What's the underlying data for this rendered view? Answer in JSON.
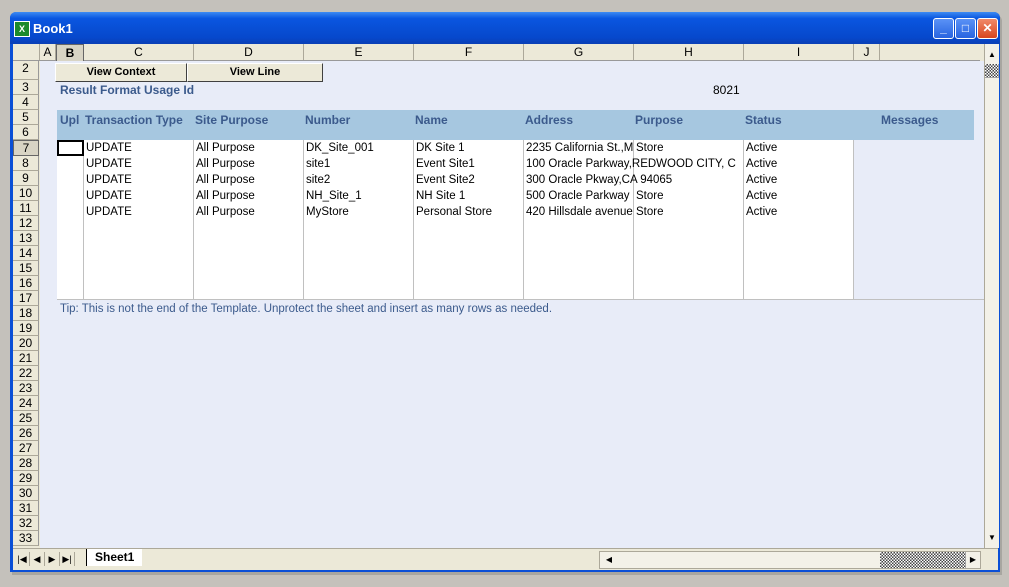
{
  "window": {
    "title": "Book1",
    "minimize_label": "_",
    "maximize_label": "□",
    "close_label": "✕",
    "app_icon": "excel-icon"
  },
  "columns": [
    "",
    "A",
    "B",
    "C",
    "D",
    "E",
    "F",
    "G",
    "H",
    "I",
    "J"
  ],
  "rows": [
    "2",
    "3",
    "4",
    "5",
    "6",
    "7",
    "8",
    "9",
    "10",
    "11",
    "12",
    "13",
    "14",
    "15",
    "16",
    "17",
    "18",
    "19",
    "20",
    "21",
    "22",
    "23",
    "24",
    "25",
    "26",
    "27",
    "28",
    "29",
    "30",
    "31",
    "32",
    "33"
  ],
  "buttons": {
    "view_context": "View Context",
    "view_line": "View Line"
  },
  "result_format": {
    "label": "Result Format Usage Id",
    "value": "8021"
  },
  "table": {
    "headers": [
      "Upl",
      "Transaction Type",
      "Site Purpose",
      "Number",
      "Name",
      "Address",
      "Purpose",
      "Status",
      "Messages"
    ],
    "rows": [
      [
        "",
        "UPDATE",
        "All Purpose",
        "DK_Site_001",
        "DK Site 1",
        "2235 California St.,M",
        "Store",
        "Active",
        ""
      ],
      [
        "",
        "UPDATE",
        "All Purpose",
        "site1",
        "Event Site1",
        "100 Oracle Parkway,REDWOOD CITY, C",
        "",
        "Active",
        ""
      ],
      [
        "",
        "UPDATE",
        "All Purpose",
        "site2",
        "Event Site2",
        "300 Oracle Pkway,CA  94065",
        "",
        "Active",
        ""
      ],
      [
        "",
        "UPDATE",
        "All Purpose",
        "NH_Site_1",
        "NH Site 1",
        "500 Oracle Parkway",
        "Store",
        "Active",
        ""
      ],
      [
        "",
        "UPDATE",
        "All Purpose",
        "MyStore",
        "Personal Store",
        "420 Hillsdale avenue",
        "Store",
        "Active",
        ""
      ]
    ]
  },
  "tip": "Tip: This is not the end of the Template.  Unprotect the sheet and insert as many rows as needed.",
  "sheet_tabs": [
    "Sheet1"
  ],
  "nav": {
    "first": "|◀",
    "prev": "◀",
    "next": "▶",
    "last": "▶|"
  },
  "scroll": {
    "up": "▲",
    "down": "▼",
    "left": "◀",
    "right": "▶"
  }
}
